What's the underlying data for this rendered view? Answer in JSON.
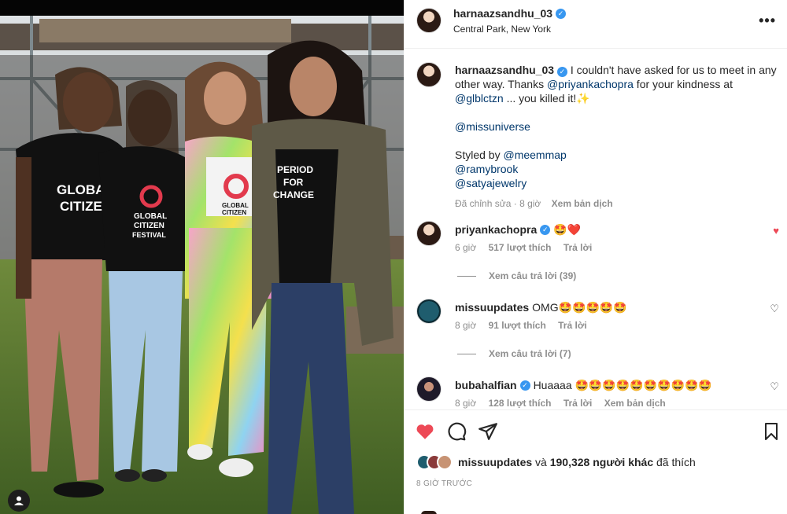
{
  "post": {
    "username": "harnaazsandhu_03",
    "location": "Central Park, New York",
    "more_label": "•••"
  },
  "caption": {
    "username": "harnaazsandhu_03",
    "text_1": " I couldn't have asked for us to meet in any other way. Thanks ",
    "mention_1": "@priyankachopra",
    "text_2": " for your kindness at ",
    "mention_2": "@glblctzn",
    "text_3": " ... you killed it!✨",
    "mention_3": "@missuniverse",
    "styled_by": "Styled by ",
    "mention_4": "@meemmap",
    "mention_5": "@ramybrook",
    "mention_6": "@satyajewelry",
    "edited": "Đã chỉnh sửa · 8 giờ",
    "translate": "Xem bản dịch"
  },
  "comments": [
    {
      "username": "priyankachopra",
      "verified": true,
      "text": "🤩❤️",
      "time": "6 giờ",
      "likes": "517 lượt thích",
      "reply": "Trả lời",
      "translate": "",
      "liked": true,
      "view_replies": "Xem câu trả lời (39)"
    },
    {
      "username": "missuupdates",
      "verified": false,
      "text": "OMG🤩🤩🤩🤩🤩",
      "time": "8 giờ",
      "likes": "91 lượt thích",
      "reply": "Trả lời",
      "translate": "",
      "liked": false,
      "view_replies": "Xem câu trả lời (7)"
    },
    {
      "username": "bubahalfian",
      "verified": true,
      "text": "Huaaaa 🤩🤩🤩🤩🤩🤩🤩🤩🤩🤩",
      "time": "8 giờ",
      "likes": "128 lượt thích",
      "reply": "Trả lời",
      "translate": "Xem bản dịch",
      "liked": false,
      "view_replies": ""
    }
  ],
  "likes_summary": {
    "first_user": "missuupdates",
    "and": " và ",
    "count": "190,328 người khác",
    "liked": " đã thích"
  },
  "post_time": "8 GIỜ TRƯỚC",
  "photo": {
    "shirt_1": "GLOBAL CITIZEN",
    "shirt_2": "GLOBAL CITIZEN FESTIVAL",
    "shirt_3": "GLOBAL CITIZEN",
    "shirt_4": "PERIOD FOR CHANGE"
  },
  "icons": {
    "like": "heart-icon",
    "comment": "comment-icon",
    "share": "share-icon",
    "save": "bookmark-icon",
    "verified": "verified-badge-icon",
    "tag": "user-tag-icon"
  },
  "colors": {
    "liked_heart": "#ed4956",
    "mention": "#00376b",
    "verified": "#3897f0",
    "muted": "#8e8e8e"
  }
}
